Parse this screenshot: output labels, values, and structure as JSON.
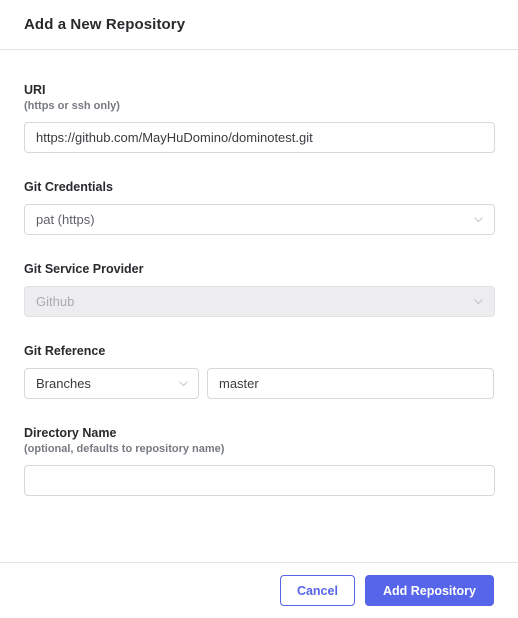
{
  "dialog": {
    "title": "Add a New Repository"
  },
  "colors": {
    "accent": "#5765ea",
    "border": "#d8d8dc",
    "divider": "#e4e4e6",
    "disabled_bg": "#ededef",
    "label": "#2a2a2e",
    "sublabel": "#767a80"
  },
  "fields": {
    "uri": {
      "label": "URI",
      "sublabel": "(https or ssh only)",
      "value": "https://github.com/MayHuDomino/dominotest.git",
      "placeholder": ""
    },
    "git_credentials": {
      "label": "Git Credentials",
      "value": "pat (https)",
      "icon": "chevron-down-icon"
    },
    "git_service_provider": {
      "label": "Git Service Provider",
      "value": "Github",
      "disabled": true,
      "icon": "chevron-down-icon"
    },
    "git_reference": {
      "label": "Git Reference",
      "kind_value": "Branches",
      "kind_icon": "chevron-down-icon",
      "ref_value": "master",
      "ref_placeholder": ""
    },
    "directory_name": {
      "label": "Directory Name",
      "sublabel": "(optional, defaults to repository name)",
      "value": "",
      "placeholder": ""
    }
  },
  "footer": {
    "cancel_label": "Cancel",
    "submit_label": "Add Repository"
  }
}
